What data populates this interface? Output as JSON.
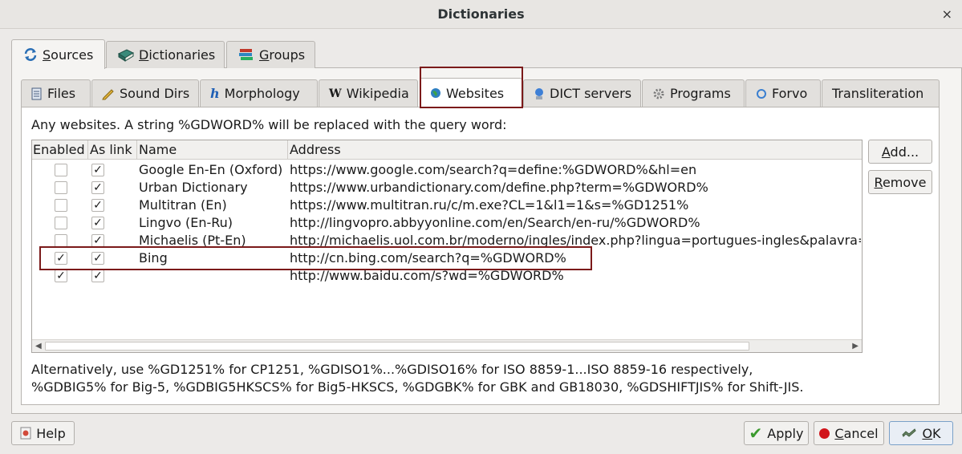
{
  "window": {
    "title": "Dictionaries",
    "close_symbol": "×"
  },
  "outer_tabs": [
    {
      "label": "Sources",
      "underline": "S",
      "rest": "ources",
      "icon": "refresh-icon",
      "active": true
    },
    {
      "label": "Dictionaries",
      "underline": "D",
      "rest": "ictionaries",
      "icon": "book-icon",
      "active": false
    },
    {
      "label": "Groups",
      "underline": "G",
      "rest": "roups",
      "icon": "books-stack-icon",
      "active": false
    }
  ],
  "inner_tabs": [
    {
      "label": "Files",
      "icon": "file-icon"
    },
    {
      "label": "Sound Dirs",
      "icon": "pencil-folder-icon"
    },
    {
      "label": "Morphology",
      "icon": "h-letter-icon"
    },
    {
      "label": "Wikipedia",
      "icon": "w-letter-icon"
    },
    {
      "label": "Websites",
      "icon": "globe-icon",
      "active": true
    },
    {
      "label": "DICT servers",
      "icon": "server-globe-icon"
    },
    {
      "label": "Programs",
      "icon": "gear-icon"
    },
    {
      "label": "Forvo",
      "icon": "forvo-icon"
    },
    {
      "label": "Transliteration",
      "icon": ""
    }
  ],
  "websites": {
    "description": "Any websites. A string %GDWORD% will be replaced with the query word:",
    "columns": [
      "Enabled",
      "As link",
      "Name",
      "Address"
    ],
    "rows": [
      {
        "enabled": false,
        "as_link": true,
        "name": "Google En-En (Oxford)",
        "address": "https://www.google.com/search?q=define:%GDWORD%&hl=en"
      },
      {
        "enabled": false,
        "as_link": true,
        "name": "Urban Dictionary",
        "address": "https://www.urbandictionary.com/define.php?term=%GDWORD%"
      },
      {
        "enabled": false,
        "as_link": true,
        "name": "Multitran (En)",
        "address": "https://www.multitran.ru/c/m.exe?CL=1&l1=1&s=%GD1251%"
      },
      {
        "enabled": false,
        "as_link": true,
        "name": "Lingvo (En-Ru)",
        "address": "http://lingvopro.abbyyonline.com/en/Search/en-ru/%GDWORD%"
      },
      {
        "enabled": false,
        "as_link": true,
        "name": "Michaelis (Pt-En)",
        "address": "http://michaelis.uol.com.br/moderno/ingles/index.php?lingua=portugues-ingles&palavra="
      },
      {
        "enabled": true,
        "as_link": true,
        "name": "Bing",
        "address": "http://cn.bing.com/search?q=%GDWORD%"
      },
      {
        "enabled": true,
        "as_link": true,
        "name": "",
        "address": "http://www.baidu.com/s?wd=%GDWORD%"
      }
    ],
    "add_button": {
      "underline": "A",
      "rest": "dd..."
    },
    "remove_button": {
      "underline": "R",
      "rest": "emove"
    },
    "alt_line1": "Alternatively, use %GD1251% for CP1251, %GDISO1%...%GDISO16% for ISO 8859-1...ISO 8859-16 respectively,",
    "alt_line2": "%GDBIG5% for Big-5, %GDBIG5HKSCS% for Big5-HKSCS, %GDGBK% for GBK and GB18030, %GDSHIFTJIS% for Shift-JIS."
  },
  "footer": {
    "help": "Help",
    "apply": "Apply",
    "cancel_u": "C",
    "cancel_rest": "ancel",
    "ok_u": "O",
    "ok_rest": "K"
  },
  "check_mark": "✓"
}
